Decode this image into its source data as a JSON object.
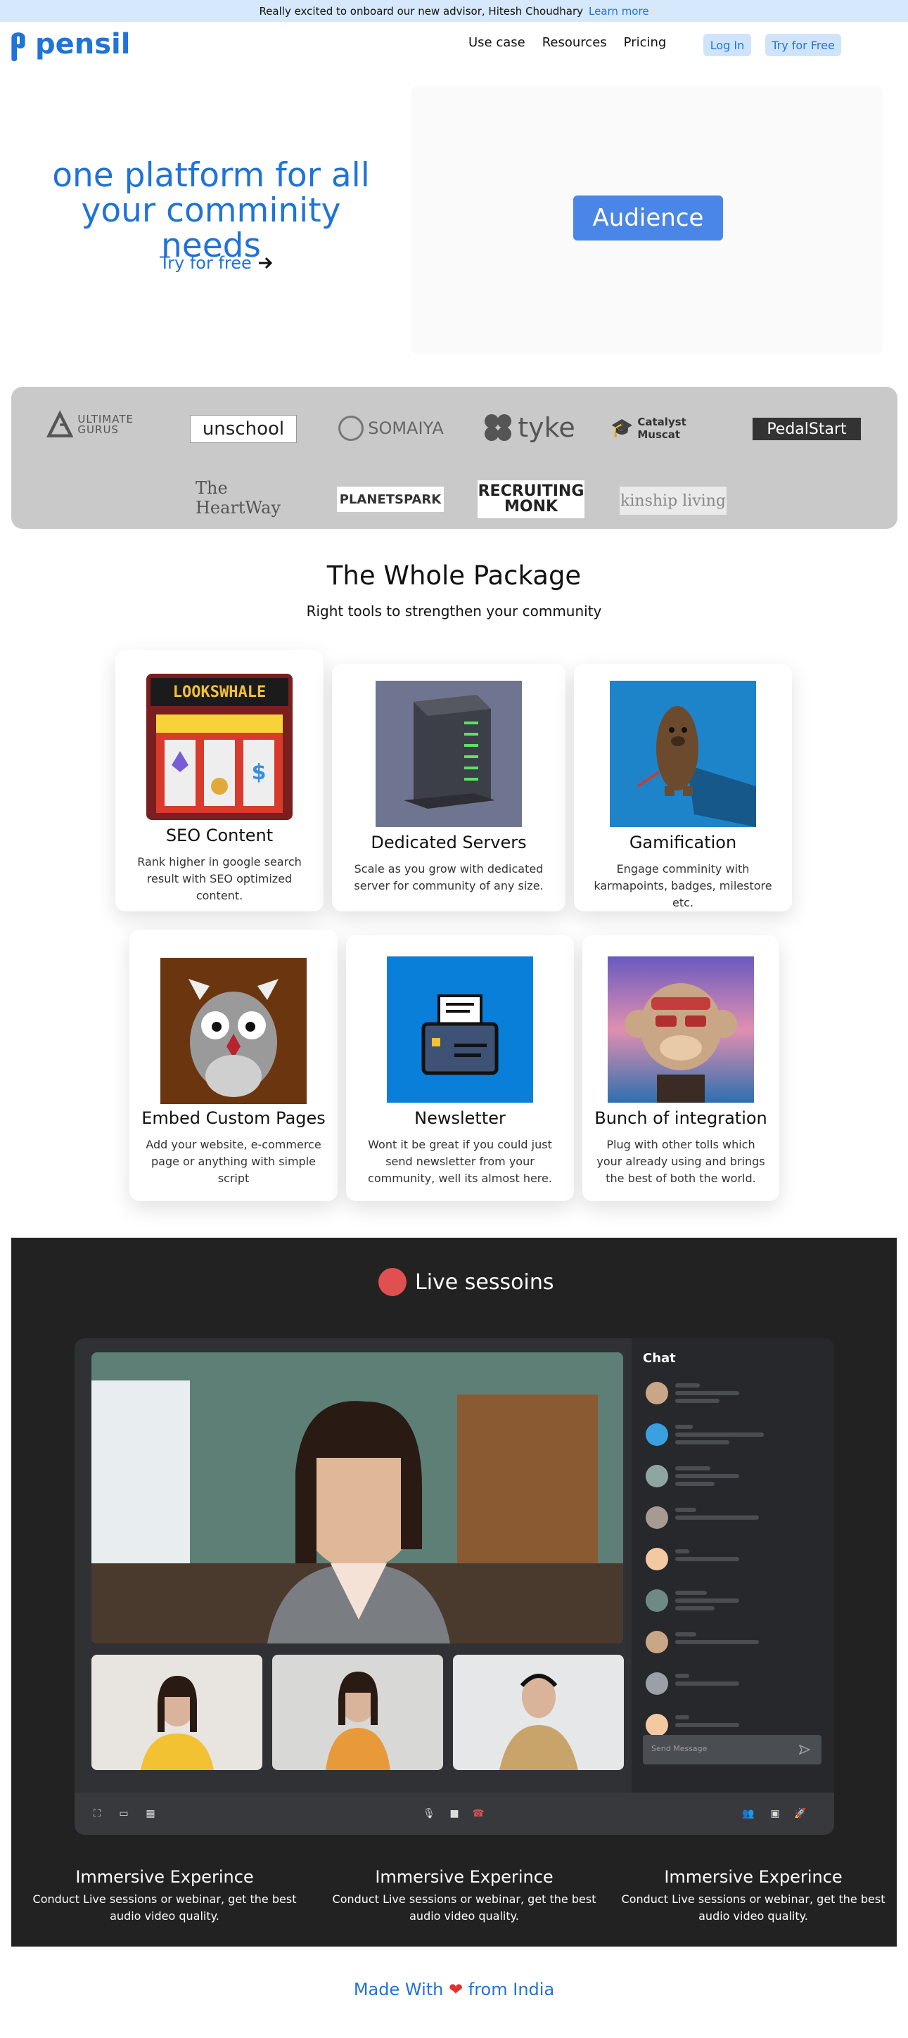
{
  "banner": {
    "text": "Really excited to onboard our new advisor, Hitesh Choudhary",
    "link": "Learn more"
  },
  "brand": {
    "name": "pensil",
    "accent": "#1f73d9"
  },
  "nav": {
    "items": [
      "Use case",
      "Resources",
      "Pricing"
    ],
    "login": "Log In",
    "try": "Try for Free"
  },
  "hero": {
    "title": "one platform for all your comminity needs",
    "cta": "Try for free",
    "panel_button": "Audience"
  },
  "logos": [
    "ULTIMATE GURUS",
    "unschool",
    "SOMAIYA",
    "tyke",
    "Catalyst Muscat",
    "PedalStart",
    "The HeartWay",
    "PLANETSPARK",
    "RECRUITING MONK",
    "kinship living"
  ],
  "package": {
    "title": "The Whole Package",
    "subtitle": "Right tools to strengthen your community",
    "cards": [
      {
        "title": "SEO Content",
        "desc": "Rank higher in google search result with SEO optimized content.",
        "art": "slot-machine-nft",
        "art_label": "LOOKSWHALE"
      },
      {
        "title": "Dedicated Servers",
        "desc": "Scale as you grow with dedicated server for community of any size.",
        "art": "server-tower"
      },
      {
        "title": "Gamification",
        "desc": "Engage comminity with karmapoints, badges, milestore etc.",
        "art": "bean-character"
      },
      {
        "title": "Embed Custom Pages",
        "desc": "Add your website, e-commerce page or anything with simple script",
        "art": "owl-character"
      },
      {
        "title": "Newsletter",
        "desc": "Wont it be great if you could just send newsletter from your community, well its almost here.",
        "art": "printer"
      },
      {
        "title": "Bunch of integration",
        "desc": "Plug with other tolls which your already using and brings the best of both the world.",
        "art": "ape-nft"
      }
    ]
  },
  "live": {
    "title": "Live sessoins",
    "chat_title": "Chat",
    "send_placeholder": "Send Message",
    "features": [
      {
        "title": "Immersive Experince",
        "desc": "Conduct Live sessions or webinar, get the best audio video quality."
      },
      {
        "title": "Immersive Experince",
        "desc": "Conduct Live sessions or webinar, get the best audio video quality."
      },
      {
        "title": "Immersive Experince",
        "desc": "Conduct Live sessions or webinar, get the best audio video quality."
      }
    ]
  },
  "footer": {
    "before": "Made With",
    "after": "from India"
  }
}
